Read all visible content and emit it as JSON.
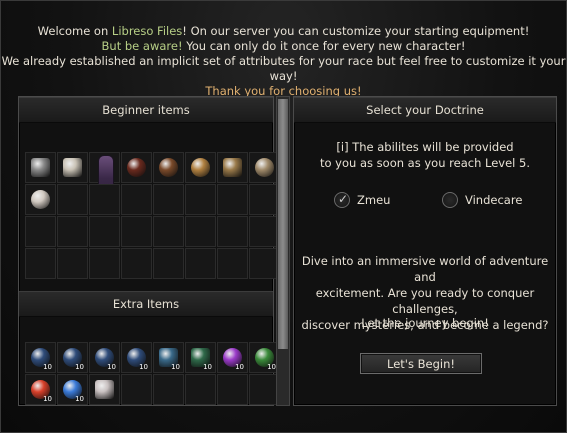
{
  "welcome": {
    "line1_a": "Welcome on ",
    "line1_b": "Libreso Files",
    "line1_c": "! On our server you can customize your starting equipment!",
    "line2_a": "But be aware!",
    "line2_b": " You can only do it once for every new character!",
    "line3": "We already established an implicit set of attributes for your race but feel free to customize it your way!",
    "line4": "Thank you for choosing us!"
  },
  "left_panel": {
    "beginner_title": "Beginner items",
    "extra_title": "Extra Items",
    "beginner_items": [
      {
        "icon": "pipe-icon",
        "color": "#8a8a8a"
      },
      {
        "icon": "fan-icon",
        "color": "#c9c2b5"
      },
      {
        "icon": "robe-icon",
        "color": "#5b3f6e"
      },
      {
        "icon": "hat-icon",
        "color": "#6a2a1e"
      },
      {
        "icon": "shield-icon",
        "color": "#7a4a2a"
      },
      {
        "icon": "ring-icon",
        "color": "#b08040"
      },
      {
        "icon": "boots-icon",
        "color": "#9a7a4a"
      },
      {
        "icon": "necklace-icon",
        "color": "#a08a6a"
      },
      {
        "icon": "earring-icon",
        "color": "#d0c8c0"
      }
    ],
    "extra_items": [
      {
        "icon": "scroll-skull-icon",
        "color": "#2f4c7a",
        "qty": "10"
      },
      {
        "icon": "scroll-skull-icon",
        "color": "#2f4c7a",
        "qty": "10"
      },
      {
        "icon": "scroll-skull-icon",
        "color": "#2f4c7a",
        "qty": "10"
      },
      {
        "icon": "scroll-skull-icon",
        "color": "#2f4c7a",
        "qty": "10"
      },
      {
        "icon": "arrow-icon",
        "color": "#3a6a8a",
        "qty": "10"
      },
      {
        "icon": "arrow-green-icon",
        "color": "#2f6a4a",
        "qty": "10"
      },
      {
        "icon": "purple-potion-icon",
        "color": "#9a3ac8",
        "qty": "10"
      },
      {
        "icon": "green-potion-icon",
        "color": "#3a8a3a",
        "qty": "10"
      },
      {
        "icon": "red-potion-icon",
        "color": "#d8402a",
        "qty": "10"
      },
      {
        "icon": "blue-potion-icon",
        "color": "#3a7ad8",
        "qty": "10"
      },
      {
        "icon": "bone-charm-icon",
        "color": "#c8c0c0",
        "qty": ""
      }
    ]
  },
  "right_panel": {
    "title": "Select your Doctrine",
    "info_line1": "[i] The abilites will be provided",
    "info_line2": "to you as soon as you reach Level 5.",
    "option_1": "Zmeu",
    "option_1_selected": true,
    "option_2": "Vindecare",
    "pitch_line1": "Dive into an immersive world of adventure and",
    "pitch_line2": "excitement. Are you ready to conquer challenges,",
    "pitch_line3": "discover mysteries, and become a legend?",
    "journey": "Let the journey begin!",
    "begin_button": "Let's Begin!"
  }
}
